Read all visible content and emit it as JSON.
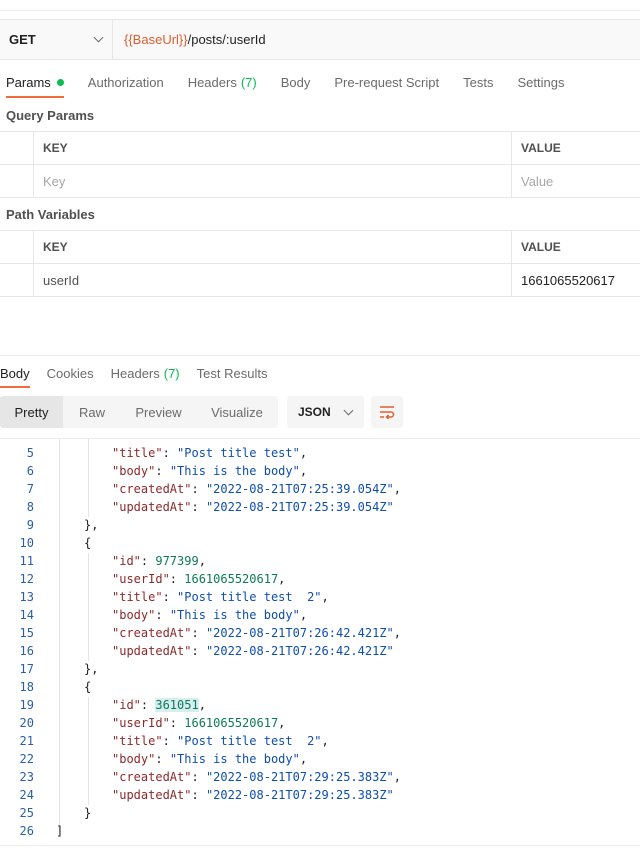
{
  "request": {
    "method": "GET",
    "url_var": "{{BaseUrl}}",
    "url_path": "/posts/:userId"
  },
  "request_tabs": [
    {
      "label": "Params",
      "active": true,
      "dot": true
    },
    {
      "label": "Authorization"
    },
    {
      "label": "Headers",
      "count": "(7)"
    },
    {
      "label": "Body"
    },
    {
      "label": "Pre-request Script"
    },
    {
      "label": "Tests"
    },
    {
      "label": "Settings"
    }
  ],
  "query_params": {
    "title": "Query Params",
    "key_header": "KEY",
    "value_header": "VALUE",
    "key_placeholder": "Key",
    "value_placeholder": "Value"
  },
  "path_variables": {
    "title": "Path Variables",
    "key_header": "KEY",
    "value_header": "VALUE",
    "rows": [
      {
        "key": "userId",
        "value": "1661065520617"
      }
    ]
  },
  "response_tabs": [
    {
      "label": "Body",
      "active": true
    },
    {
      "label": "Cookies"
    },
    {
      "label": "Headers",
      "count": "(7)"
    },
    {
      "label": "Test Results"
    }
  ],
  "view_modes": [
    "Pretty",
    "Raw",
    "Preview",
    "Visualize"
  ],
  "active_view": "Pretty",
  "format": "JSON",
  "code_lines": [
    {
      "n": "5",
      "t": "\"title\": \"Post title test\","
    },
    {
      "n": "6",
      "t": "\"body\": \"This is the body\","
    },
    {
      "n": "7",
      "t": "\"createdAt\": \"2022-08-21T07:25:39.054Z\","
    },
    {
      "n": "8",
      "t": "\"updatedAt\": \"2022-08-21T07:25:39.054Z\""
    },
    {
      "n": "9",
      "t": "},"
    },
    {
      "n": "10",
      "t": "{"
    },
    {
      "n": "11",
      "t": "\"id\": 977399,"
    },
    {
      "n": "12",
      "t": "\"userId\": 1661065520617,"
    },
    {
      "n": "13",
      "t": "\"title\": \"Post title test  2\","
    },
    {
      "n": "14",
      "t": "\"body\": \"This is the body\","
    },
    {
      "n": "15",
      "t": "\"createdAt\": \"2022-08-21T07:26:42.421Z\","
    },
    {
      "n": "16",
      "t": "\"updatedAt\": \"2022-08-21T07:26:42.421Z\""
    },
    {
      "n": "17",
      "t": "},"
    },
    {
      "n": "18",
      "t": "{"
    },
    {
      "n": "19",
      "t": "\"id\": 361051,"
    },
    {
      "n": "20",
      "t": "\"userId\": 1661065520617,"
    },
    {
      "n": "21",
      "t": "\"title\": \"Post title test  2\","
    },
    {
      "n": "22",
      "t": "\"body\": \"This is the body\","
    },
    {
      "n": "23",
      "t": "\"createdAt\": \"2022-08-21T07:29:25.383Z\","
    },
    {
      "n": "24",
      "t": "\"updatedAt\": \"2022-08-21T07:29:25.383Z\""
    },
    {
      "n": "25",
      "t": "}"
    },
    {
      "n": "26",
      "t": "]"
    }
  ],
  "highlight_value": "361051",
  "colors": {
    "accent": "#f26b3a",
    "url_variable": "#e05e2d",
    "success_green": "#0cbb52",
    "json_key": "#8b2a2a",
    "json_string": "#0e4eae",
    "json_number": "#0e7a56"
  }
}
